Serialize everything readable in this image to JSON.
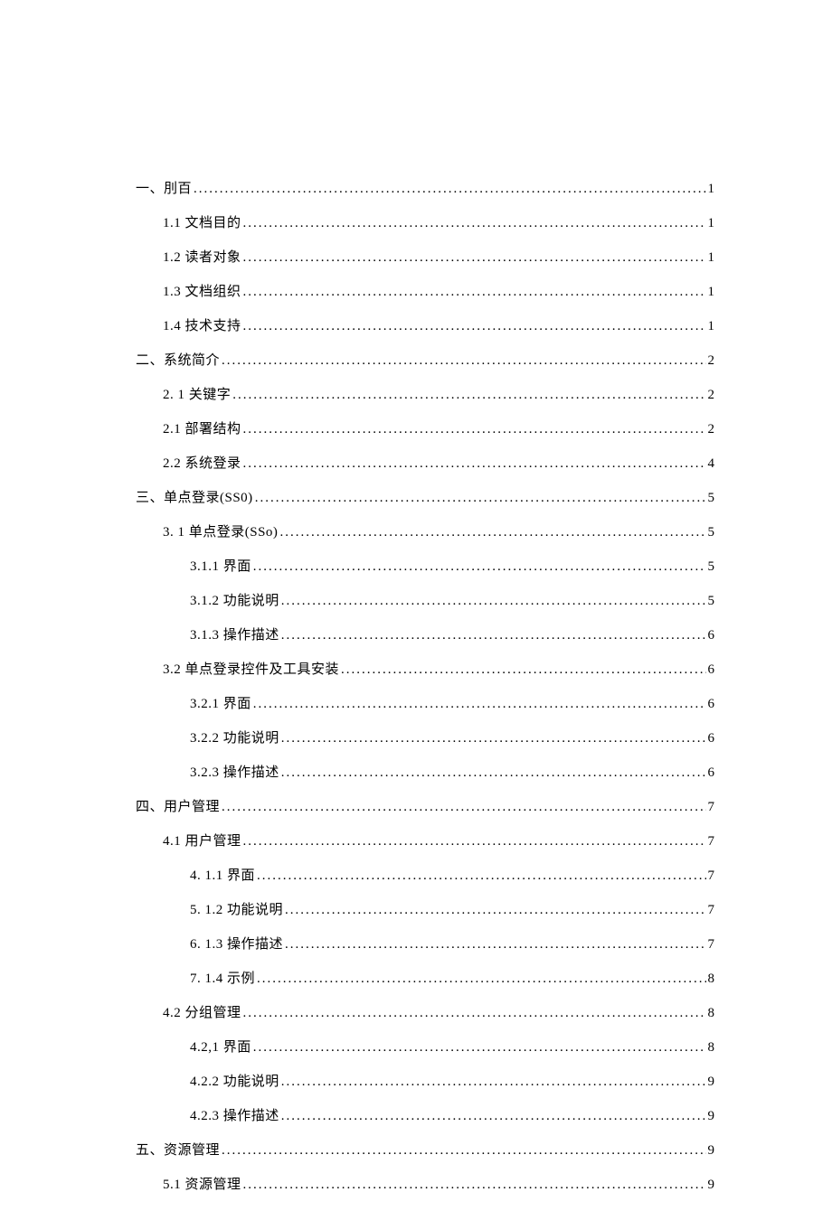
{
  "toc": [
    {
      "level": 1,
      "label": "一、刖百",
      "page": "1"
    },
    {
      "level": 2,
      "label": "1.1  文档目的 ",
      "page": "1"
    },
    {
      "level": 2,
      "label": "1.2  读者对象 ",
      "page": "1"
    },
    {
      "level": 2,
      "label": "1.3  文档组织 ",
      "page": "1"
    },
    {
      "level": 2,
      "label": "1.4  技术支持 ",
      "page": "1"
    },
    {
      "level": 1,
      "label": "二、系统简介",
      "page": "2"
    },
    {
      "level": 2,
      "label": "2.  1 关键字",
      "page": "2"
    },
    {
      "level": 2,
      "label": "2.1  部署结构 ",
      "page": "2"
    },
    {
      "level": 2,
      "label": "2.2  系统登录 ",
      "page": "4"
    },
    {
      "level": 1,
      "label": "三、单点登录(SS0)",
      "page": "5"
    },
    {
      "level": 2,
      "label": "3.  1 单点登录(SSo)",
      "page": "5"
    },
    {
      "level": 3,
      "label": "3.1.1 界面 ",
      "page": "5"
    },
    {
      "level": 3,
      "label": "3.1.2 功能说明 ",
      "page": "5"
    },
    {
      "level": 3,
      "label": "3.1.3 操作描述 ",
      "page": "6"
    },
    {
      "level": 2,
      "label": "3.2 单点登录控件及工具安装",
      "page": "6"
    },
    {
      "level": 3,
      "label": "3.2.1 界面 ",
      "page": "6"
    },
    {
      "level": 3,
      "label": "3.2.2 功能说明 ",
      "page": "6"
    },
    {
      "level": 3,
      "label": "3.2.3 操作描述 ",
      "page": "6"
    },
    {
      "level": 1,
      "label": "四、用户管理",
      "page": "7"
    },
    {
      "level": 2,
      "label": "4.1  用户管理 ",
      "page": "7"
    },
    {
      "level": 3,
      "label": "4.  1.1 界面 ",
      "page": "7"
    },
    {
      "level": 3,
      "label": "5.  1.2 功能说明 ",
      "page": "7"
    },
    {
      "level": 3,
      "label": "6.  1.3 操作描述 ",
      "page": "7"
    },
    {
      "level": 3,
      "label": "7.  1.4 示例 ",
      "page": "8"
    },
    {
      "level": 2,
      "label": "4.2  分组管理 ",
      "page": "8"
    },
    {
      "level": 3,
      "label": "4.2,1 界面 ",
      "page": "8"
    },
    {
      "level": 3,
      "label": "4.2.2 功能说明 ",
      "page": "9"
    },
    {
      "level": 3,
      "label": "4.2.3 操作描述 ",
      "page": "9"
    },
    {
      "level": 1,
      "label": "五、资源管理",
      "page": "9"
    },
    {
      "level": 2,
      "label": "5.1 资源管理",
      "page": "9"
    }
  ]
}
